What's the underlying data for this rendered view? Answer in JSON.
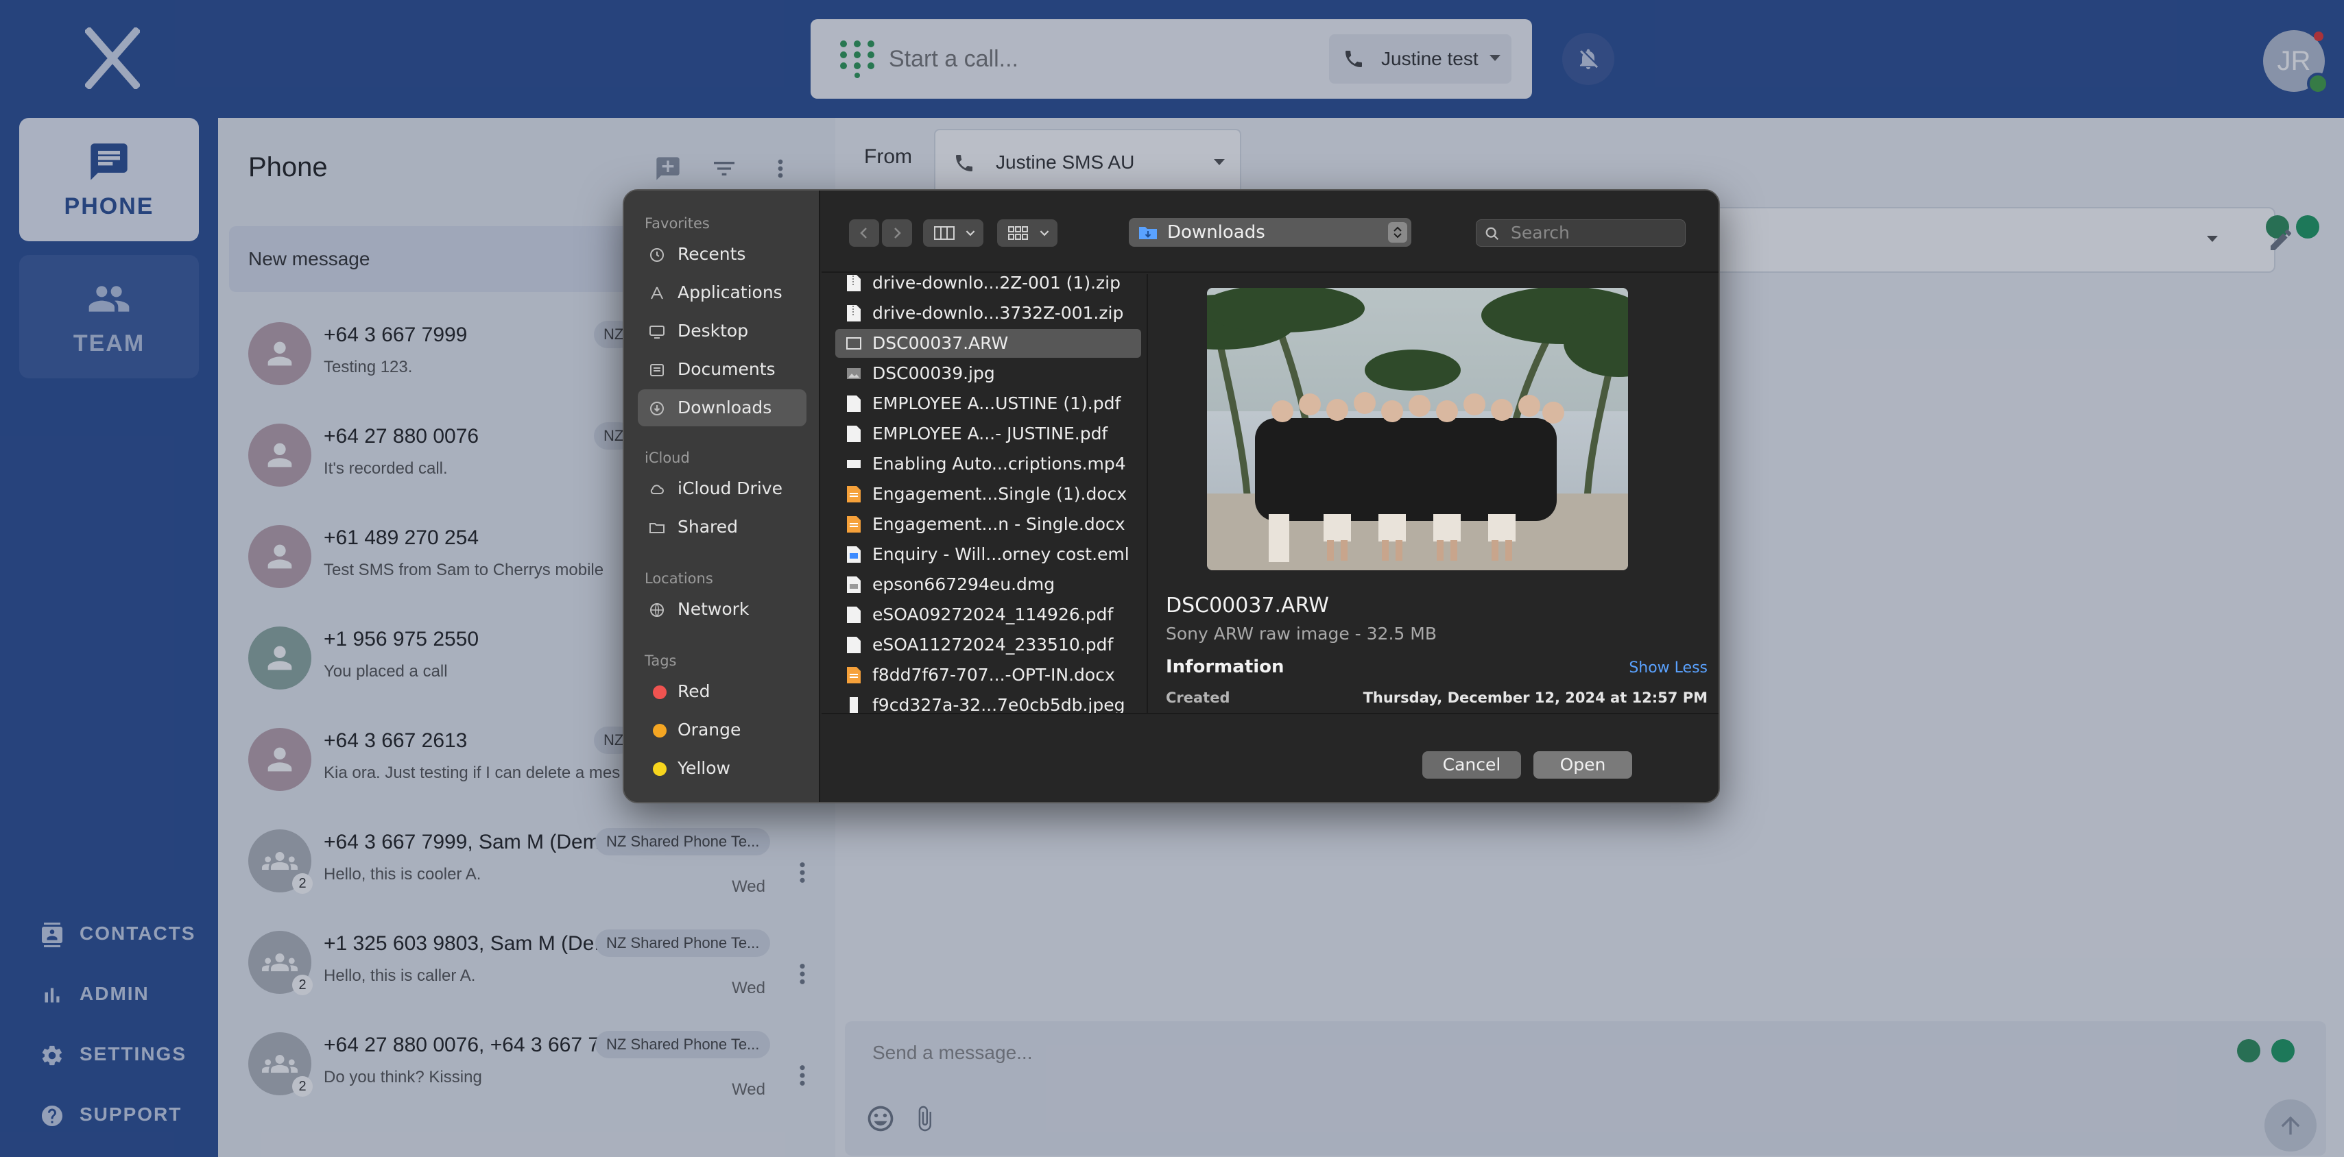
{
  "topbar": {
    "call_placeholder": "Start a call...",
    "caller_id": "Justine test",
    "avatar_initials": "JR"
  },
  "rail": {
    "phone_label": "PHONE",
    "team_label": "TEAM",
    "links": [
      "CONTACTS",
      "ADMIN",
      "SETTINGS",
      "SUPPORT"
    ]
  },
  "list": {
    "title": "Phone",
    "new_message": "New message",
    "conversations": [
      {
        "name": "+64 3 667 7999",
        "preview": "Testing 123.",
        "tag": "NZ",
        "day": ""
      },
      {
        "name": "+64 27 880 0076",
        "preview": "It's recorded call.",
        "tag": "NZ",
        "day": ""
      },
      {
        "name": "+61 489 270 254",
        "preview": "Test SMS from Sam to Cherrys mobile",
        "tag": "",
        "day": ""
      },
      {
        "name": "+1 956 975 2550",
        "preview": "You placed a call",
        "tag": "",
        "day": ""
      },
      {
        "name": "+64 3 667 2613",
        "preview": "Kia ora. Just testing if I can delete a mes",
        "tag": "NZ",
        "day": ""
      },
      {
        "name": "+64 3 667 7999, Sam M (Dem...",
        "preview": "Hello, this is cooler A.",
        "tag": "NZ Shared Phone Te...",
        "day": "Wed",
        "count": "2"
      },
      {
        "name": "+1 325 603 9803, Sam M (De...",
        "preview": "Hello, this is caller A.",
        "tag": "NZ Shared Phone Te...",
        "day": "Wed",
        "count": "2"
      },
      {
        "name": "+64 27 880 0076, +64 3 667 7...",
        "preview": "Do you think? Kissing",
        "tag": "NZ Shared Phone Te...",
        "day": "Wed",
        "count": "2"
      }
    ]
  },
  "chat": {
    "from_label": "From",
    "from_value": "Justine SMS AU",
    "compose_placeholder": "Send a message..."
  },
  "dialog": {
    "favorites_label": "Favorites",
    "favorites": [
      "Recents",
      "Applications",
      "Desktop",
      "Documents",
      "Downloads"
    ],
    "icloud_label": "iCloud",
    "icloud": [
      "iCloud Drive",
      "Shared"
    ],
    "locations_label": "Locations",
    "locations": [
      "Network"
    ],
    "tags_label": "Tags",
    "tags": [
      {
        "name": "Red",
        "color": "#ef5350"
      },
      {
        "name": "Orange",
        "color": "#f5a623"
      },
      {
        "name": "Yellow",
        "color": "#f7d51d"
      }
    ],
    "location": "Downloads",
    "search_placeholder": "Search",
    "files": [
      "drive-downlo...2Z-001 (1).zip",
      "drive-downlo...3732Z-001.zip",
      "DSC00037.ARW",
      "DSC00039.jpg",
      "EMPLOYEE A...USTINE (1).pdf",
      "EMPLOYEE A...- JUSTINE.pdf",
      "Enabling Auto...criptions.mp4",
      "Engagement...Single (1).docx",
      "Engagement...n - Single.docx",
      "Enquiry - Will...orney cost.eml",
      "epson667294eu.dmg",
      "eSOA09272024_114926.pdf",
      "eSOA11272024_233510.pdf",
      "f8dd7f67-707...-OPT-IN.docx",
      "f9cd327a-32...7e0cb5db.jpeg"
    ],
    "preview": {
      "name": "DSC00037.ARW",
      "description": "Sony ARW raw image - 32.5 MB",
      "info_heading": "Information",
      "show_less": "Show Less",
      "created_label": "Created",
      "created_value": "Thursday, December 12, 2024 at 12:57 PM"
    },
    "cancel_label": "Cancel",
    "open_label": "Open"
  },
  "colors": {
    "brand": "#2c4f94",
    "accent_link": "#5aa2ff",
    "dialog_bg": "#262626"
  }
}
